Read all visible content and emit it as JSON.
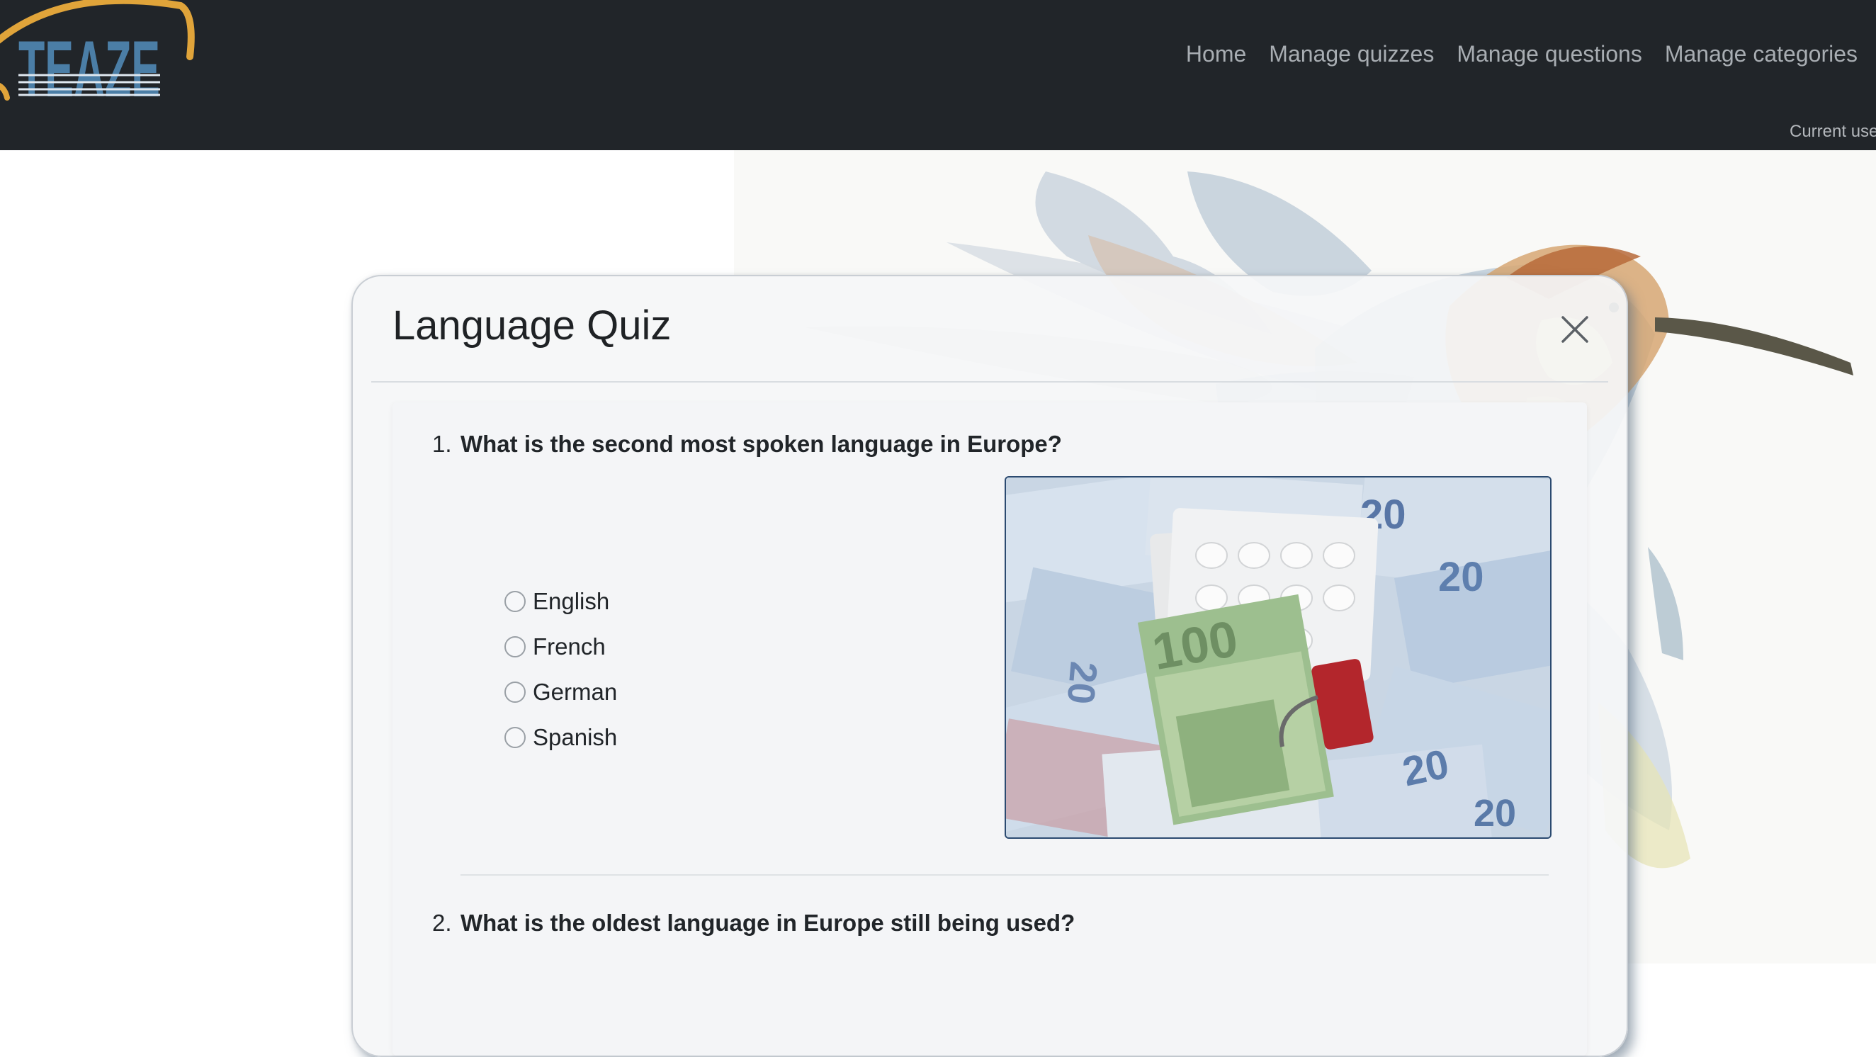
{
  "navbar": {
    "logo_text": "TEAZE",
    "links": [
      "Home",
      "Manage quizzes",
      "Manage questions",
      "Manage categories"
    ],
    "current_user": "Current use"
  },
  "modal": {
    "title": "Language Quiz",
    "close_icon": "close-icon",
    "questions": [
      {
        "number": "1.",
        "text": "What is the second most spoken language in Europe?",
        "options": [
          "English",
          "French",
          "German",
          "Spanish"
        ],
        "image": "euro-banknotes-image",
        "banknote_values": [
          "20",
          "20",
          "100",
          "20",
          "20",
          "20"
        ]
      },
      {
        "number": "2.",
        "text": "What is the oldest language in Europe still being used?"
      }
    ]
  },
  "colors": {
    "navbar": "#212529",
    "nav_link": "#a8adb2",
    "logo_blue": "#4b7ea6",
    "logo_arc": "#e0a43a",
    "image_border": "#2b4a70"
  }
}
